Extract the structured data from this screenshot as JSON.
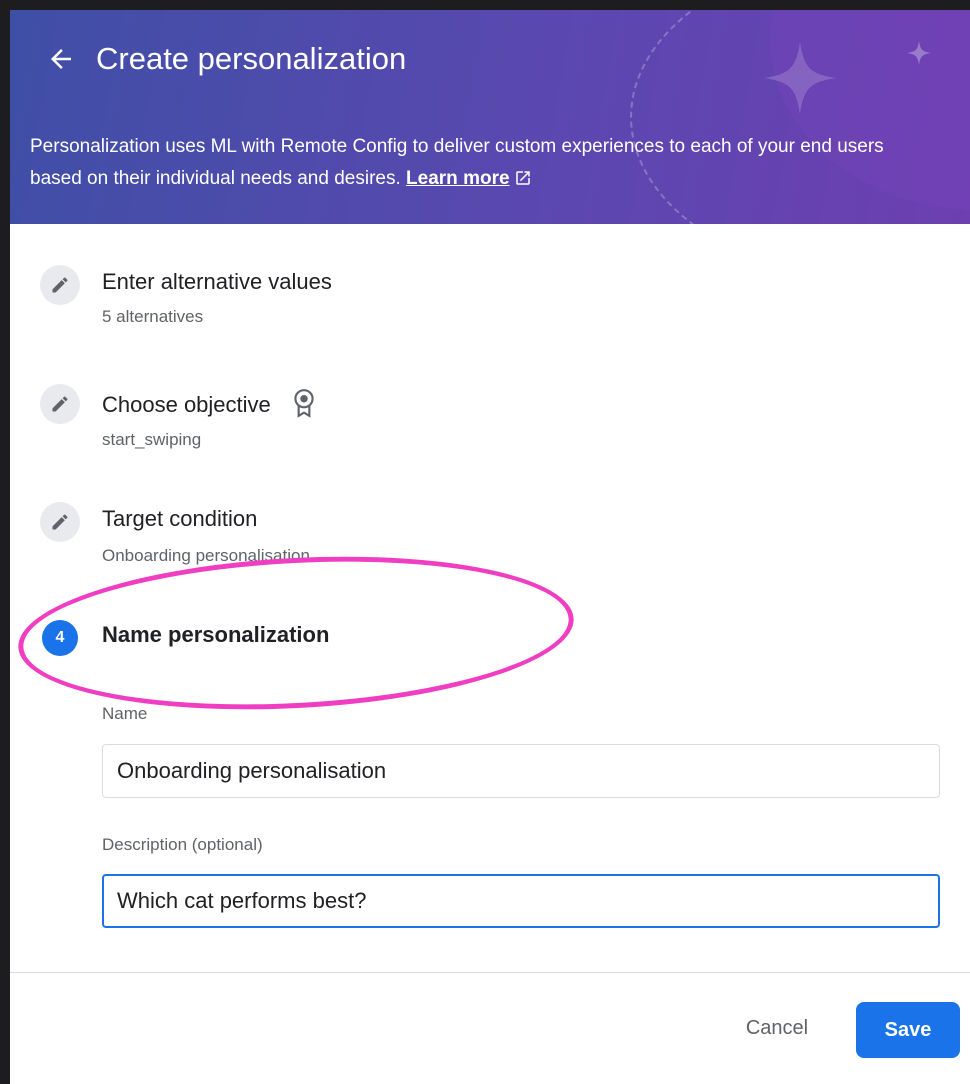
{
  "header": {
    "title": "Create personalization",
    "description": "Personalization uses ML with Remote Config to deliver custom experiences to each of your end users based on their individual needs and desires.",
    "learn_more": "Learn more"
  },
  "steps": [
    {
      "title": "Enter alternative values",
      "subtitle": "5 alternatives",
      "icon": "pencil-icon"
    },
    {
      "title": "Choose objective",
      "subtitle": "start_swiping",
      "icon": "pencil-icon",
      "extra_icon": "award-icon"
    },
    {
      "title": "Target condition",
      "subtitle": "Onboarding personalisation",
      "icon": "pencil-icon"
    },
    {
      "title": "Name personalization",
      "number": "4",
      "active": true
    }
  ],
  "form": {
    "name_label": "Name",
    "name_value": "Onboarding personalisation",
    "description_label": "Description (optional)",
    "description_value": "Which cat performs best?"
  },
  "footer": {
    "cancel_label": "Cancel",
    "save_label": "Save"
  },
  "colors": {
    "accent": "#1a73e8",
    "annotation": "#f03ec2",
    "header_start": "#3f4fa6",
    "header_end": "#6d3fb0"
  }
}
